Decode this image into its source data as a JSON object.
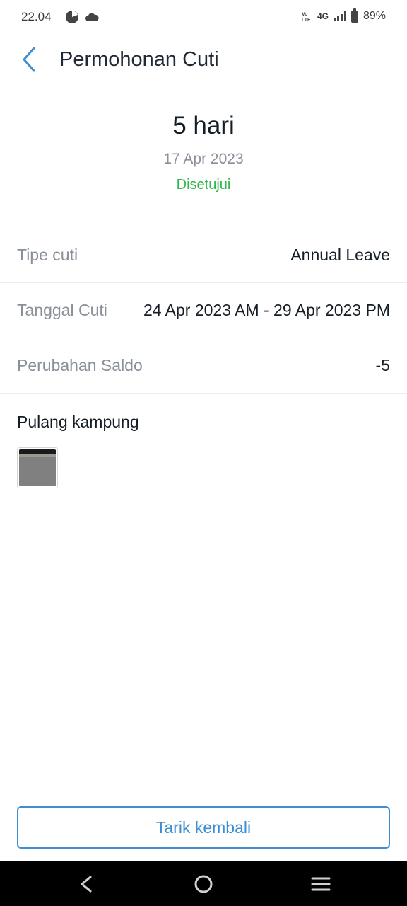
{
  "status_bar": {
    "time": "22.04",
    "network": "4G",
    "battery": "89%",
    "icons": [
      "pie-chart-icon",
      "cloud-icon",
      "volte-icon",
      "signal-icon",
      "battery-icon"
    ]
  },
  "header": {
    "title": "Permohonan Cuti",
    "back_icon": "chevron-left-icon"
  },
  "summary": {
    "days": "5 hari",
    "date": "17 Apr 2023",
    "status": "Disetujui"
  },
  "details": [
    {
      "label": "Tipe cuti",
      "value": "Annual Leave"
    },
    {
      "label": "Tanggal Cuti",
      "value": "24 Apr 2023 AM - 29 Apr 2023 PM"
    },
    {
      "label": "Perubahan Saldo",
      "value": "-5"
    }
  ],
  "note": {
    "text": "Pulang kampung"
  },
  "actions": {
    "withdraw_label": "Tarik kembali"
  },
  "nav_bar": {
    "icons": [
      "back-triangle-icon",
      "home-circle-icon",
      "recents-menu-icon"
    ]
  },
  "colors": {
    "accent": "#3f8fd0",
    "approved": "#2eb84b",
    "muted": "#8a9099",
    "text": "#141c26"
  }
}
